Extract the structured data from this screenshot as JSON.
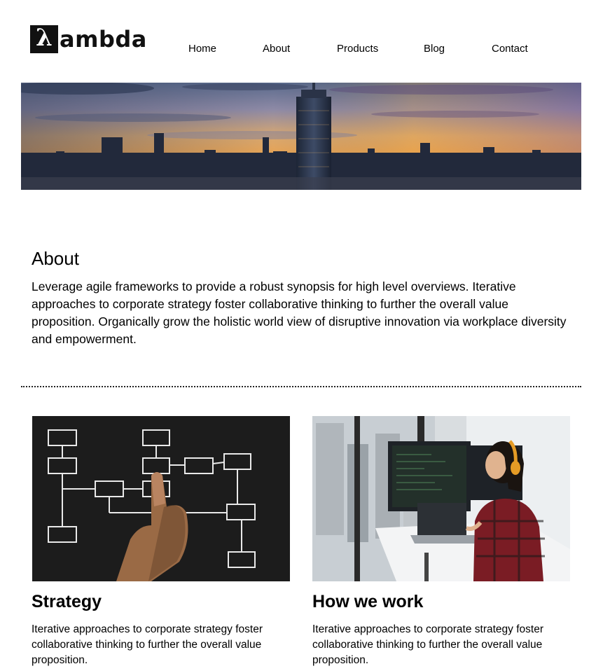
{
  "brand": {
    "logo_symbol": "λ",
    "logo_text": "ambda"
  },
  "nav": {
    "items": [
      "Home",
      "About",
      "Products",
      "Blog",
      "Contact"
    ]
  },
  "about": {
    "title": "About",
    "body": "Leverage agile frameworks to provide a robust synopsis for high level overviews. Iterative approaches to corporate strategy foster collaborative thinking to further the overall value proposition. Organically grow the holistic world view of disruptive innovation via workplace diversity and empowerment."
  },
  "cards": [
    {
      "title": "Strategy",
      "body": "Iterative approaches to corporate strategy foster collaborative thinking to further the overall value proposition."
    },
    {
      "title": "How we work",
      "body": "Iterative approaches to corporate strategy foster collaborative thinking to further the overall value proposition."
    }
  ],
  "colors": {
    "text": "#000000",
    "logo_bg": "#111111",
    "chalkboard": "#1c1c1c",
    "sky_orange": "#e9a24f"
  }
}
